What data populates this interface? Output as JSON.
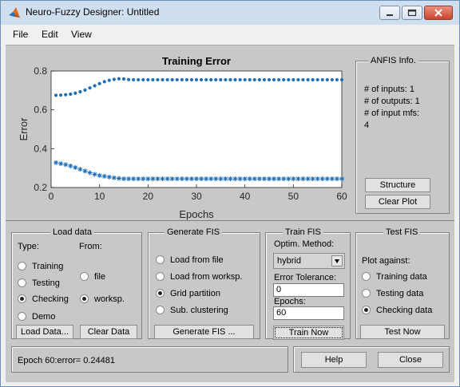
{
  "window": {
    "title": "Neuro-Fuzzy Designer: Untitled"
  },
  "menu": {
    "file": "File",
    "edit": "Edit",
    "view": "View"
  },
  "anfis_info": {
    "title": "ANFIS Info.",
    "inputs": "# of inputs: 1",
    "outputs": "# of outputs: 1",
    "input_mfs": "# of input mfs:",
    "input_mfs_value": "4",
    "structure_button": "Structure",
    "clear_plot_button": "Clear Plot"
  },
  "load_data": {
    "title": "Load data",
    "type_label": "Type:",
    "from_label": "From:",
    "types": [
      "Training",
      "Testing",
      "Checking",
      "Demo"
    ],
    "selected_type": "Checking",
    "sources": [
      "file",
      "worksp."
    ],
    "selected_source": "worksp.",
    "load_button": "Load Data...",
    "clear_button": "Clear Data"
  },
  "generate_fis": {
    "title": "Generate FIS",
    "options": [
      "Load from file",
      "Load from worksp.",
      "Grid partition",
      "Sub. clustering"
    ],
    "selected": "Grid partition",
    "button": "Generate FIS ..."
  },
  "train_fis": {
    "title": "Train FIS",
    "method_label": "Optim. Method:",
    "method_value": "hybrid",
    "tolerance_label": "Error Tolerance:",
    "tolerance_value": "0",
    "epochs_label": "Epochs:",
    "epochs_value": "60",
    "button": "Train Now"
  },
  "test_fis": {
    "title": "Test FIS",
    "plot_against_label": "Plot against:",
    "options": [
      "Training data",
      "Testing data",
      "Checking data"
    ],
    "selected": "Checking data",
    "button": "Test Now"
  },
  "status": {
    "text": "Epoch 60:error= 0.24481"
  },
  "footer": {
    "help_button": "Help",
    "close_button": "Close"
  },
  "colors": {
    "marker": "#1f6fb4",
    "figure_bg": "#c8c8c8"
  },
  "chart_data": {
    "type": "scatter",
    "title": "Training Error",
    "xlabel": "Epochs",
    "ylabel": "Error",
    "xlim": [
      0,
      60
    ],
    "ylim": [
      0.2,
      0.8
    ],
    "xticks": [
      "0",
      "10",
      "20",
      "30",
      "40",
      "50",
      "60"
    ],
    "yticks": [
      "0.2",
      "0.4",
      "0.6",
      "0.8"
    ],
    "grid": false,
    "series": [
      {
        "marker": "dot",
        "x": [
          1,
          2,
          3,
          4,
          5,
          6,
          7,
          8,
          9,
          10,
          11,
          12,
          13,
          14,
          15,
          16,
          17,
          18,
          19,
          20,
          21,
          22,
          23,
          24,
          25,
          26,
          27,
          28,
          29,
          30,
          31,
          32,
          33,
          34,
          35,
          36,
          37,
          38,
          39,
          40,
          41,
          42,
          43,
          44,
          45,
          46,
          47,
          48,
          49,
          50,
          51,
          52,
          53,
          54,
          55,
          56,
          57,
          58,
          59,
          60
        ],
        "y": [
          0.675,
          0.676,
          0.678,
          0.681,
          0.686,
          0.693,
          0.702,
          0.713,
          0.724,
          0.735,
          0.745,
          0.752,
          0.757,
          0.76,
          0.759,
          0.756,
          0.755,
          0.755,
          0.755,
          0.755,
          0.755,
          0.755,
          0.755,
          0.755,
          0.755,
          0.755,
          0.755,
          0.755,
          0.755,
          0.755,
          0.755,
          0.755,
          0.755,
          0.755,
          0.755,
          0.755,
          0.755,
          0.755,
          0.755,
          0.755,
          0.755,
          0.755,
          0.755,
          0.755,
          0.755,
          0.755,
          0.755,
          0.755,
          0.755,
          0.755,
          0.755,
          0.755,
          0.755,
          0.755,
          0.755,
          0.755,
          0.755,
          0.755,
          0.755,
          0.755
        ]
      },
      {
        "marker": "asterisk",
        "x": [
          1,
          2,
          3,
          4,
          5,
          6,
          7,
          8,
          9,
          10,
          11,
          12,
          13,
          14,
          15,
          16,
          17,
          18,
          19,
          20,
          21,
          22,
          23,
          24,
          25,
          26,
          27,
          28,
          29,
          30,
          31,
          32,
          33,
          34,
          35,
          36,
          37,
          38,
          39,
          40,
          41,
          42,
          43,
          44,
          45,
          46,
          47,
          48,
          49,
          50,
          51,
          52,
          53,
          54,
          55,
          56,
          57,
          58,
          59,
          60
        ],
        "y": [
          0.328,
          0.323,
          0.318,
          0.311,
          0.303,
          0.294,
          0.285,
          0.276,
          0.268,
          0.262,
          0.258,
          0.254,
          0.25,
          0.247,
          0.245,
          0.2448,
          0.2448,
          0.2448,
          0.2448,
          0.2448,
          0.2448,
          0.2448,
          0.2448,
          0.2448,
          0.2448,
          0.2448,
          0.2448,
          0.2448,
          0.2448,
          0.2448,
          0.2448,
          0.2448,
          0.2448,
          0.2448,
          0.2448,
          0.2448,
          0.2448,
          0.2448,
          0.2448,
          0.2448,
          0.2448,
          0.2448,
          0.2448,
          0.2448,
          0.2448,
          0.2448,
          0.2448,
          0.2448,
          0.2448,
          0.2448,
          0.2448,
          0.2448,
          0.2448,
          0.2448,
          0.2448,
          0.2448,
          0.2448,
          0.2448,
          0.2448,
          0.2448
        ]
      }
    ]
  }
}
